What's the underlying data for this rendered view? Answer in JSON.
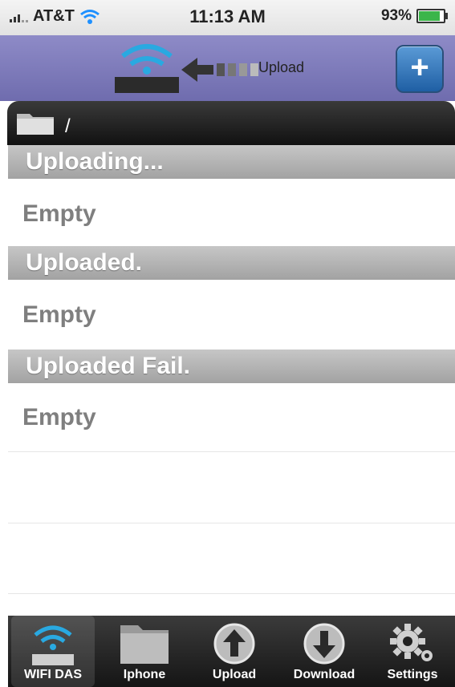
{
  "status_bar": {
    "carrier": "AT&T",
    "time": "11:13 AM",
    "battery": "93%"
  },
  "nav_bar": {
    "upload_label": "Upload",
    "add_button": "+"
  },
  "path_bar": {
    "path": "/"
  },
  "sections": [
    {
      "header": "Uploading...",
      "row": "Empty"
    },
    {
      "header": "Uploaded.",
      "row": "Empty"
    },
    {
      "header": "Uploaded Fail.",
      "row": "Empty"
    }
  ],
  "tabs": [
    {
      "label": "WIFI DAS",
      "icon": "wifi-drive-icon",
      "active": true
    },
    {
      "label": "Iphone",
      "icon": "folder-icon",
      "active": false
    },
    {
      "label": "Upload",
      "icon": "upload-arrow-icon",
      "active": false
    },
    {
      "label": "Download",
      "icon": "download-arrow-icon",
      "active": false
    },
    {
      "label": "Settings",
      "icon": "gear-icon",
      "active": false
    }
  ]
}
